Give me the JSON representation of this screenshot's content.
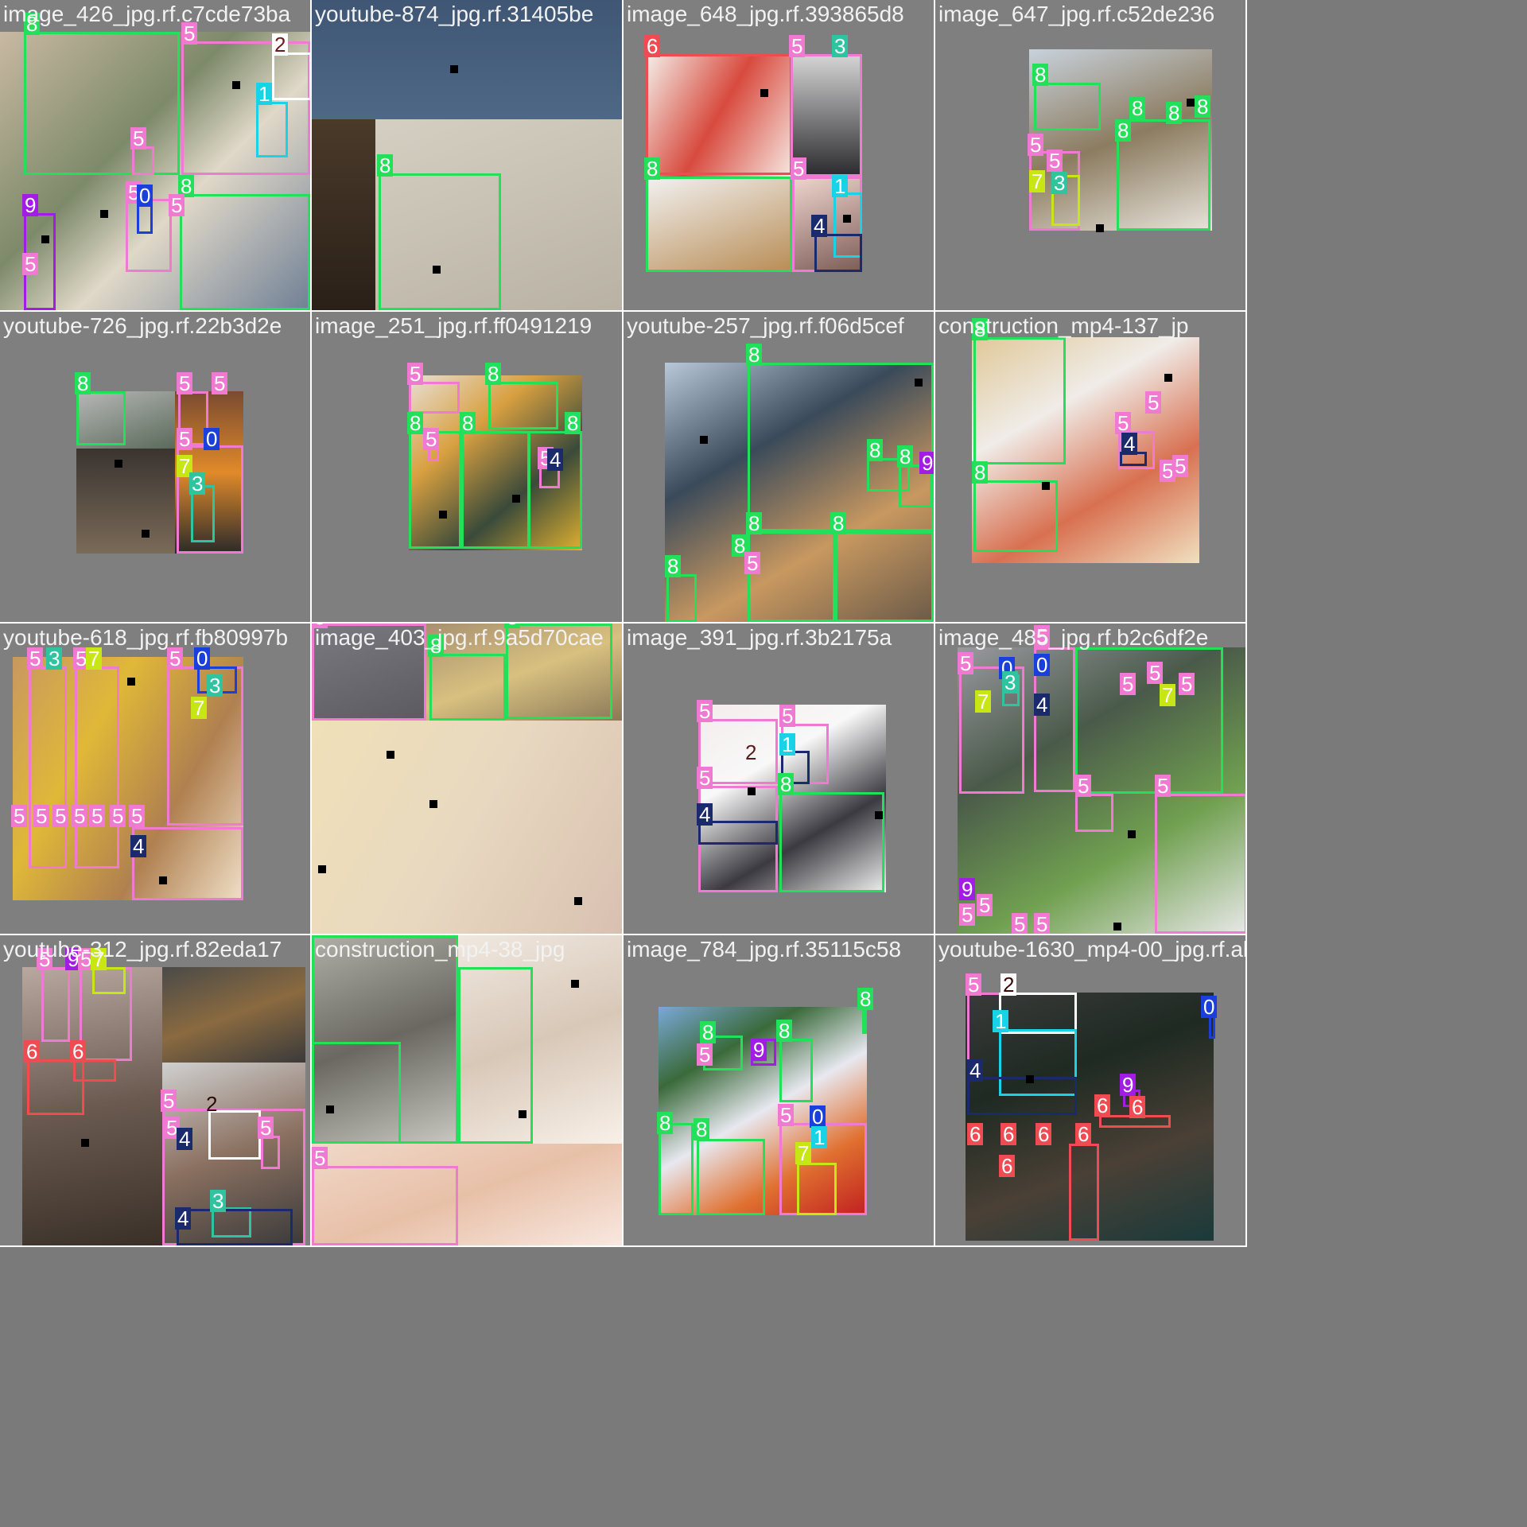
{
  "tiles": [
    {
      "caption": "image_426_jpg.rf.c7cde73ba",
      "labels": [
        "8",
        "5",
        "2",
        "1",
        "5",
        "5",
        "0",
        "9",
        "8",
        "5",
        "5"
      ]
    },
    {
      "caption": "youtube-874_jpg.rf.31405be",
      "labels": [
        "8"
      ]
    },
    {
      "caption": "image_648_jpg.rf.393865d8",
      "labels": [
        "6",
        "5",
        "3",
        "8",
        "5",
        "1",
        "4"
      ]
    },
    {
      "caption": "image_647_jpg.rf.c52de236",
      "labels": [
        "8",
        "8",
        "8",
        "8",
        "8",
        "5",
        "5",
        "7",
        "3"
      ]
    },
    {
      "caption": "youtube-726_jpg.rf.22b3d2e",
      "labels": [
        "8",
        "5",
        "5",
        "5",
        "0",
        "7",
        "3"
      ]
    },
    {
      "caption": "image_251_jpg.rf.ff0491219",
      "labels": [
        "5",
        "8",
        "8",
        "8",
        "8",
        "5",
        "5",
        "4"
      ]
    },
    {
      "caption": "youtube-257_jpg.rf.f06d5cef",
      "labels": [
        "8",
        "8",
        "8",
        "9",
        "8",
        "8",
        "8",
        "5",
        "8"
      ]
    },
    {
      "caption": "construction_mp4-137_jp",
      "labels": [
        "8",
        "5",
        "5",
        "4",
        "5",
        "5",
        "8"
      ]
    },
    {
      "caption": "youtube-618_jpg.rf.fb80997b",
      "labels": [
        "5",
        "3",
        "5",
        "7",
        "5",
        "0",
        "3",
        "7",
        "5",
        "5",
        "5",
        "5",
        "5",
        "5",
        "5",
        "4"
      ]
    },
    {
      "caption": "image_403_jpg.rf.9a5d70cae",
      "labels": [
        "5",
        "8",
        "8"
      ]
    },
    {
      "caption": "image_391_jpg.rf.3b2175a",
      "labels": [
        "5",
        "5",
        "2",
        "1",
        "5",
        "8",
        "4"
      ]
    },
    {
      "caption": "image_485_jpg.rf.b2c6df2e",
      "labels": [
        "5",
        "5",
        "0",
        "3",
        "0",
        "4",
        "7",
        "5",
        "5",
        "5",
        "7",
        "5",
        "5",
        "9",
        "5",
        "5",
        "5",
        "5"
      ]
    },
    {
      "caption": "youtube-312_jpg.rf.82eda17",
      "labels": [
        "5",
        "9",
        "5",
        "7",
        "6",
        "6",
        "5",
        "2",
        "5",
        "5",
        "4",
        "3",
        "4"
      ]
    },
    {
      "caption": "construction_mp4-38_jpg",
      "labels": [
        "8",
        "5"
      ]
    },
    {
      "caption": "image_784_jpg.rf.35115c58",
      "labels": [
        "8",
        "8",
        "5",
        "9",
        "8",
        "8",
        "8",
        "5",
        "0",
        "7",
        "1"
      ]
    },
    {
      "caption": "youtube-1630_mp4-00_jpg.rf.ab",
      "labels": [
        "5",
        "2",
        "1",
        "0",
        "4",
        "9",
        "6",
        "6",
        "6",
        "6",
        "6",
        "6",
        "6"
      ]
    }
  ],
  "colors": {
    "class_0": "#1a3fdc",
    "class_1": "#1ad2e6",
    "class_2": "#ffffff",
    "class_3": "#2ec4a0",
    "class_4": "#1a2a6c",
    "class_5": "#f07ad2",
    "class_6": "#f04b52",
    "class_7": "#c8e614",
    "class_8": "#22e05a",
    "class_9": "#a21ce6"
  }
}
